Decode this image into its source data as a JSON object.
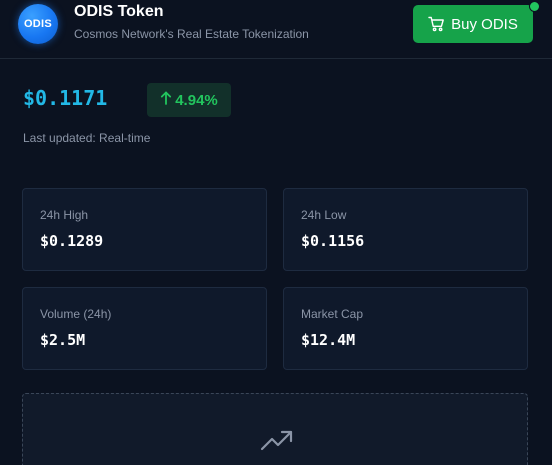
{
  "header": {
    "logo_text": "ODIS",
    "title": "ODIS Token",
    "subtitle": "Cosmos Network's Real Estate Tokenization",
    "buy_label": "Buy ODIS",
    "status_color": "#22c55e"
  },
  "price": {
    "value": "$0.1171",
    "change": "4.94%",
    "change_direction": "up",
    "updated": "Last updated: Real-time"
  },
  "stats": [
    {
      "label": "24h High",
      "value": "$0.1289"
    },
    {
      "label": "24h Low",
      "value": "$0.1156"
    },
    {
      "label": "Volume (24h)",
      "value": "$2.5M"
    },
    {
      "label": "Market Cap",
      "value": "$12.4M"
    }
  ],
  "chart": {
    "icon": "trending-up-icon"
  },
  "colors": {
    "background": "#0b1220",
    "accent_price": "#22b8e6",
    "positive": "#22c55e",
    "buy_button": "#16a34a"
  }
}
